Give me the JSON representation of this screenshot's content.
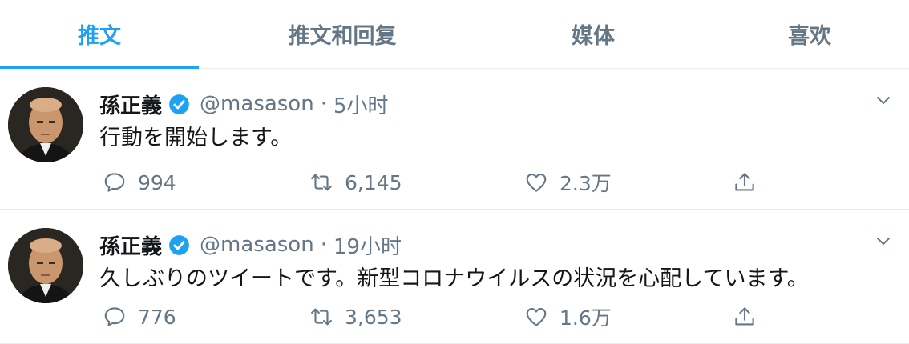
{
  "tabs": [
    {
      "label": "推文"
    },
    {
      "label": "推文和回复"
    },
    {
      "label": "媒体"
    },
    {
      "label": "喜欢"
    }
  ],
  "accent_color": "#1da1f2",
  "tweets": [
    {
      "name": "孫正義",
      "handle": "@masason",
      "time": "5小时",
      "text": "行動を開始します。",
      "replies": "994",
      "retweets": "6,145",
      "likes": "2.3万"
    },
    {
      "name": "孫正義",
      "handle": "@masason",
      "time": "19小时",
      "text": "久しぶりのツイートです。新型コロナウイルスの状況を心配しています。",
      "replies": "776",
      "retweets": "3,653",
      "likes": "1.6万"
    }
  ],
  "separator": "·"
}
